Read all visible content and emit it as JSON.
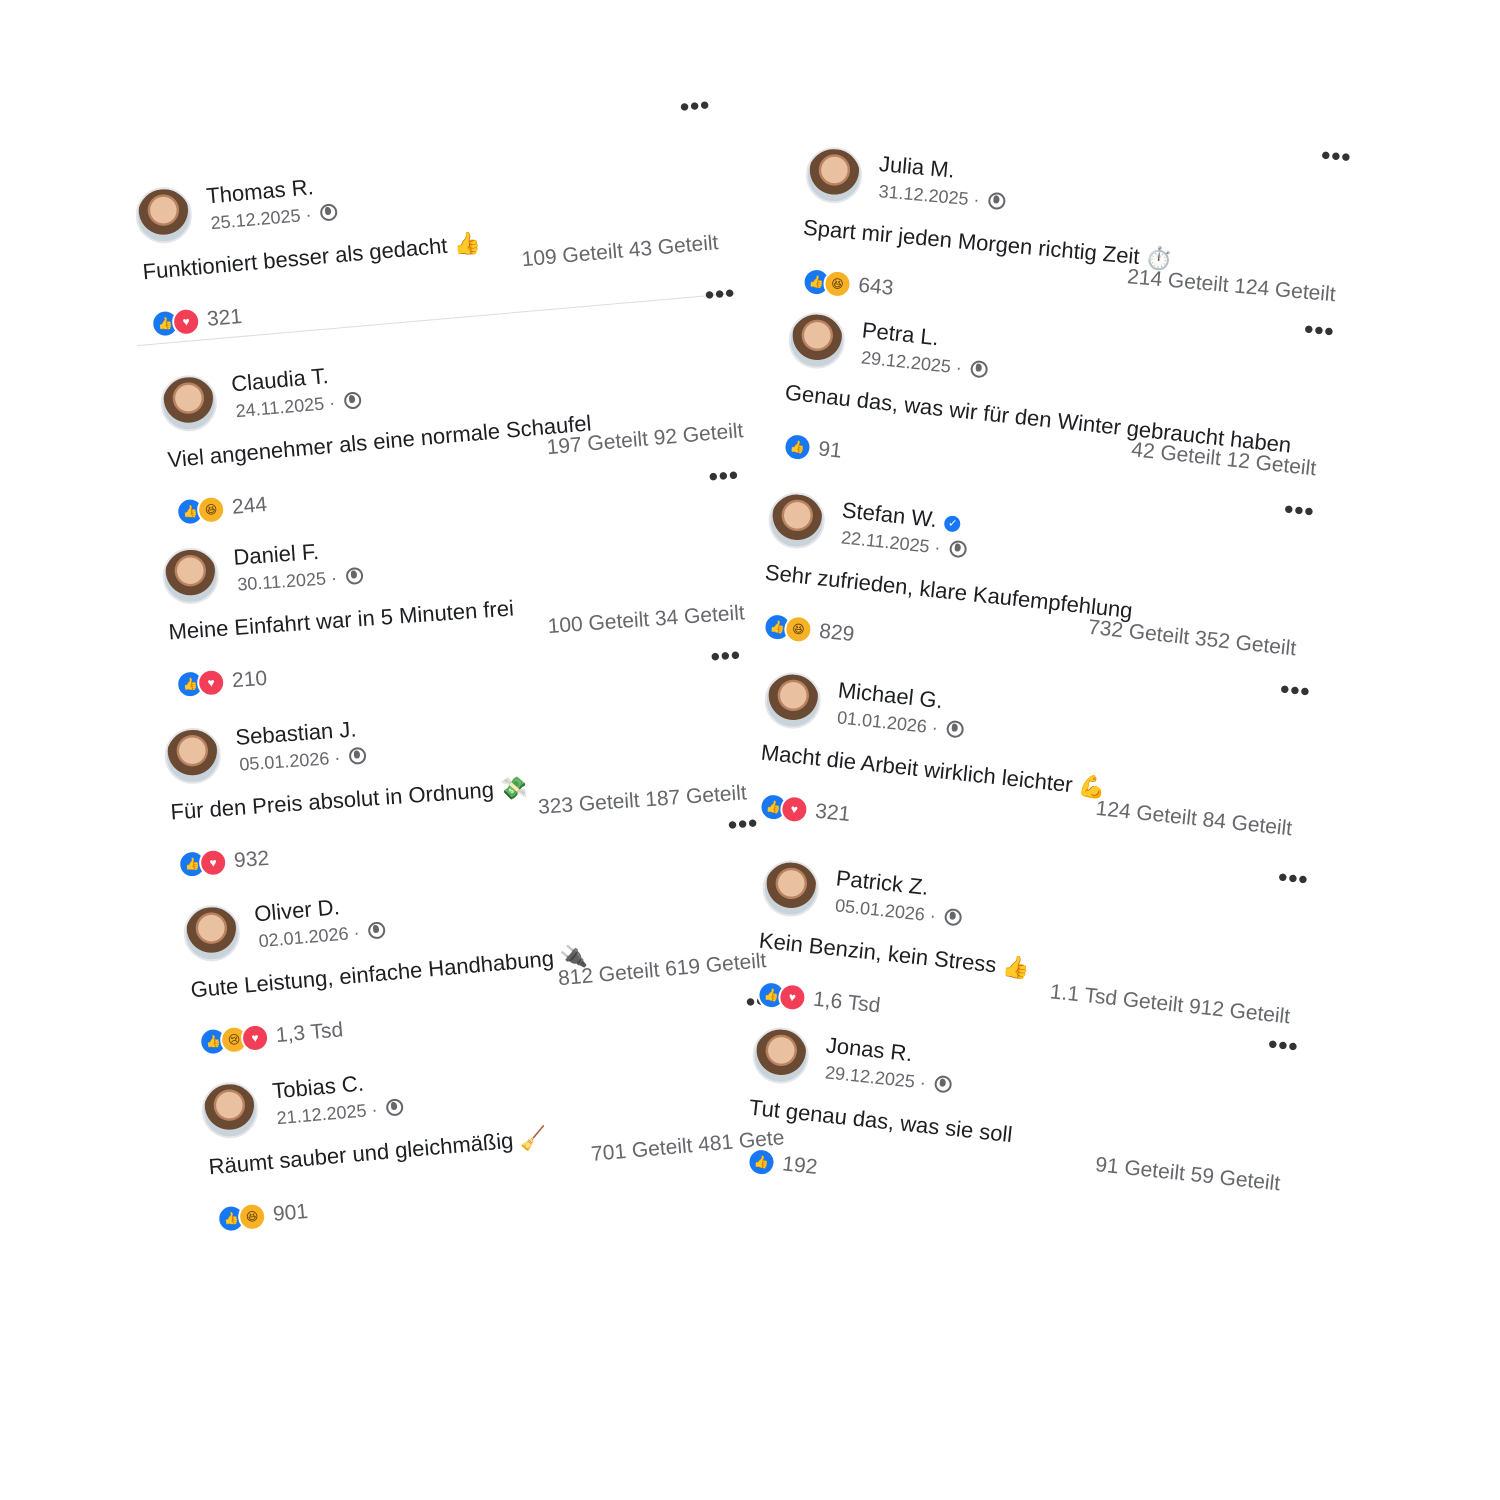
{
  "left_column": [
    {
      "name": "Thomas R.",
      "date": "25.12.2025",
      "text": "Funktioniert besser als gedacht 👍",
      "shares": "109 Geteilt 43 Geteilt",
      "reactions": [
        "like",
        "love"
      ],
      "count": "321"
    },
    {
      "name": "Claudia T.",
      "date": "24.11.2025",
      "text": "Viel angenehmer als eine normale Schaufel",
      "shares": "197 Geteilt 92 Geteilt",
      "reactions": [
        "like",
        "haha"
      ],
      "count": "244"
    },
    {
      "name": "Daniel F.",
      "date": "30.11.2025",
      "text": "Meine Einfahrt war in 5 Minuten frei",
      "shares": "100 Geteilt 34 Geteilt",
      "reactions": [
        "like",
        "love"
      ],
      "count": "210"
    },
    {
      "name": "Sebastian J.",
      "date": "05.01.2026",
      "text": "Für den Preis absolut in Ordnung 💸",
      "shares": "323 Geteilt 187 Geteilt",
      "reactions": [
        "like",
        "love"
      ],
      "count": "932"
    },
    {
      "name": "Oliver D.",
      "date": "02.01.2026",
      "text": "Gute Leistung, einfache Handhabung 🔌",
      "shares": "812 Geteilt 619 Geteilt",
      "reactions": [
        "like",
        "sad",
        "love"
      ],
      "count": "1,3 Tsd"
    },
    {
      "name": "Tobias C.",
      "date": "21.12.2025",
      "text": "Räumt sauber und gleichmäßig 🧹",
      "shares": "701 Geteilt 481 Gete",
      "reactions": [
        "like",
        "haha"
      ],
      "count": "901"
    }
  ],
  "right_column": [
    {
      "name": "Julia M.",
      "date": "31.12.2025",
      "text": "Spart mir jeden Morgen richtig Zeit ⏱️",
      "shares": "214 Geteilt 124 Geteilt",
      "reactions": [
        "like",
        "haha"
      ],
      "count": "643",
      "verified": false
    },
    {
      "name": "Petra L.",
      "date": "29.12.2025",
      "text": "Genau das, was wir für den Winter gebraucht haben",
      "shares": "42 Geteilt 12 Geteilt",
      "reactions": [
        "like"
      ],
      "count": "91",
      "verified": false
    },
    {
      "name": "Stefan W.",
      "date": "22.11.2025",
      "text": "Sehr zufrieden, klare Kaufempfehlung",
      "shares": "732 Geteilt 352 Geteilt",
      "reactions": [
        "like",
        "haha"
      ],
      "count": "829",
      "verified": true
    },
    {
      "name": "Michael G.",
      "date": "01.01.2026",
      "text": "Macht die Arbeit wirklich leichter 💪",
      "shares": "124 Geteilt 84 Geteilt",
      "reactions": [
        "like",
        "love"
      ],
      "count": "321",
      "verified": false
    },
    {
      "name": "Patrick Z.",
      "date": "05.01.2026",
      "text": "Kein Benzin, kein Stress 👍",
      "shares": "1.1 Tsd Geteilt 912 Geteilt",
      "reactions": [
        "like",
        "love"
      ],
      "count": "1,6 Tsd",
      "verified": false
    },
    {
      "name": "Jonas R.",
      "date": "29.12.2025",
      "text": "Tut genau das, was sie soll",
      "shares": "91 Geteilt 59 Geteilt",
      "reactions": [
        "like"
      ],
      "count": "192",
      "verified": false
    }
  ],
  "ui": {
    "more_symbol": "•••",
    "separator_dot": "·",
    "verified_mark": "✓"
  },
  "reaction_symbols": {
    "like": "👍",
    "love": "♥",
    "haha": "😆",
    "sad": "😢"
  },
  "colors": {
    "like": "#1877f2",
    "love": "#f33e58",
    "text": "#1c1e21",
    "muted": "#65676b"
  }
}
